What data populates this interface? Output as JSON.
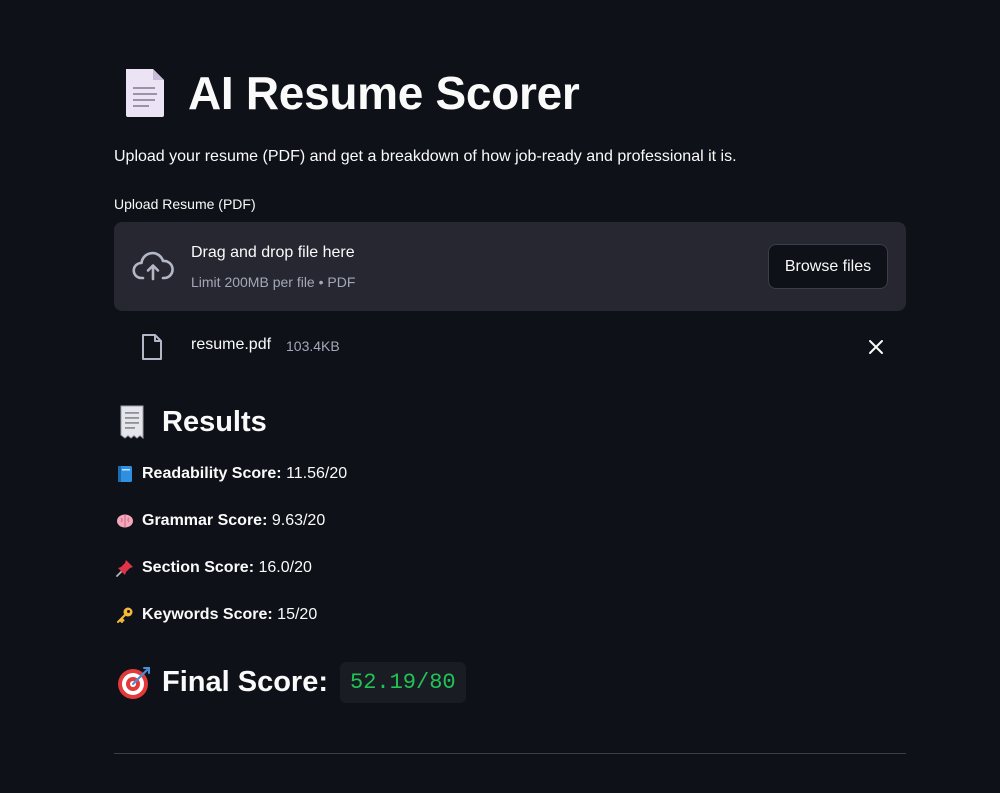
{
  "header": {
    "title": "AI Resume Scorer",
    "subtitle": "Upload your resume (PDF) and get a breakdown of how job-ready and professional it is."
  },
  "uploader": {
    "label": "Upload Resume (PDF)",
    "drop_title": "Drag and drop file here",
    "limit_text": "Limit 200MB per file • PDF",
    "browse_label": "Browse files",
    "icon": "cloud-upload-icon"
  },
  "uploaded_file": {
    "name": "resume.pdf",
    "size": "103.4KB"
  },
  "results": {
    "heading": "Results",
    "scores": [
      {
        "icon": "blue-book-icon",
        "label": "Readability Score:",
        "value": "11.56/20"
      },
      {
        "icon": "brain-icon",
        "label": "Grammar Score:",
        "value": "9.63/20"
      },
      {
        "icon": "pushpin-icon",
        "label": "Section Score:",
        "value": "16.0/20"
      },
      {
        "icon": "key-icon",
        "label": "Keywords Score:",
        "value": "15/20"
      }
    ],
    "final_label": "Final Score:",
    "final_value": "52.19/80"
  },
  "colors": {
    "background": "#0e1117",
    "panel": "#262730",
    "text": "#fafafa",
    "muted": "#a3a8b8",
    "accent_green": "#21c354"
  }
}
